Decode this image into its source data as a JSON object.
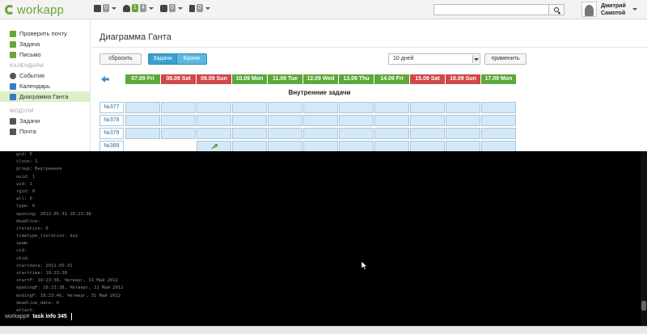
{
  "topbar": {
    "logo_text": "workapp",
    "counters": [
      {
        "icon": "tasks-icon",
        "value": "0"
      },
      {
        "icon": "users-icon",
        "value": "1",
        "value2": "4"
      },
      {
        "icon": "chat-icon",
        "value": "0"
      },
      {
        "icon": "trash-icon",
        "value": "0"
      }
    ],
    "search": {
      "placeholder": "",
      "value": ""
    },
    "user": {
      "first_name": "Дмитрий",
      "last_name": "Самотой"
    }
  },
  "sidebar": {
    "top_items": [
      {
        "label": "Проверить почту",
        "icon": "mail-check-icon",
        "color": "#6aa736"
      },
      {
        "label": "Задача",
        "icon": "task-add-icon",
        "color": "#6aa736"
      },
      {
        "label": "Письмо",
        "icon": "letter-icon",
        "color": "#6aa736"
      }
    ],
    "calendars_heading": "КАЛЕНДАРИ",
    "calendar_items": [
      {
        "label": "События",
        "icon": "events-icon",
        "color": "#555"
      },
      {
        "label": "Календарь",
        "icon": "calendar-icon",
        "color": "#3a7bbf"
      },
      {
        "label": "Диаграмма Ганта",
        "icon": "gantt-icon",
        "color": "#3a7bbf"
      }
    ],
    "modules_heading": "МОДУЛИ",
    "module_items": [
      {
        "label": "Задачи",
        "icon": "tasks-module-icon",
        "color": "#555"
      },
      {
        "label": "Почта",
        "icon": "mail-module-icon",
        "color": "#555"
      }
    ]
  },
  "main": {
    "title": "Диаграмма Ганта",
    "reset_label": "сбросить",
    "tab_tasks": "Задачи",
    "tab_bookings": "Брони",
    "period_value": "10 дней",
    "apply_label": "применить",
    "days": [
      {
        "label": "07.09 Fri",
        "color": "green"
      },
      {
        "label": "08.09 Sat",
        "color": "red"
      },
      {
        "label": "09.09 Sun",
        "color": "red"
      },
      {
        "label": "10.09 Mon",
        "color": "green"
      },
      {
        "label": "11.09 Tue",
        "color": "green"
      },
      {
        "label": "12.09 Wed",
        "color": "green"
      },
      {
        "label": "13.09 Thu",
        "color": "green"
      },
      {
        "label": "14.09 Fri",
        "color": "green"
      },
      {
        "label": "15.09 Sat",
        "color": "red"
      },
      {
        "label": "16.09 Sun",
        "color": "red"
      },
      {
        "label": "17.09 Mon",
        "color": "green"
      }
    ],
    "section_title": "Внутренние задачи",
    "tasks": [
      {
        "id": "№377",
        "cells": [
          1,
          1,
          1,
          1,
          1,
          1,
          1,
          1,
          1,
          1,
          1
        ]
      },
      {
        "id": "№378",
        "cells": [
          1,
          1,
          1,
          1,
          1,
          1,
          1,
          1,
          1,
          1,
          1
        ]
      },
      {
        "id": "№379",
        "cells": [
          1,
          1,
          1,
          1,
          1,
          1,
          1,
          1,
          1,
          1,
          1
        ]
      },
      {
        "id": "№389",
        "cells": [
          0,
          0,
          2,
          1,
          1,
          1,
          1,
          1,
          1,
          1,
          1
        ]
      }
    ]
  },
  "terminal": {
    "lines": [
      "gid: 0",
      "close: 1",
      "group: Внутренняя",
      "ouid: 1",
      "uid: 1",
      "rgid: 0",
      "all: 0",
      "type: 0",
      "opening: 2012-05-31 18:23:38",
      "deadline:",
      "iteration: 0",
      "timetype_iteration: day",
      "spam:",
      "cid:",
      "chid:",
      "startdate: 2012-05-31",
      "starttime: 18:23:38",
      "startF: 18:23:38, Четверг, 31 Май 2012",
      "openingF: 18:23:38, Четверг, 31 Май 2012",
      "endingF: 18:23:46, Четверг, 31 Май 2012",
      "deadline_date: 0",
      "attach:"
    ],
    "prompt": "workapp#",
    "command": "task info 345"
  }
}
